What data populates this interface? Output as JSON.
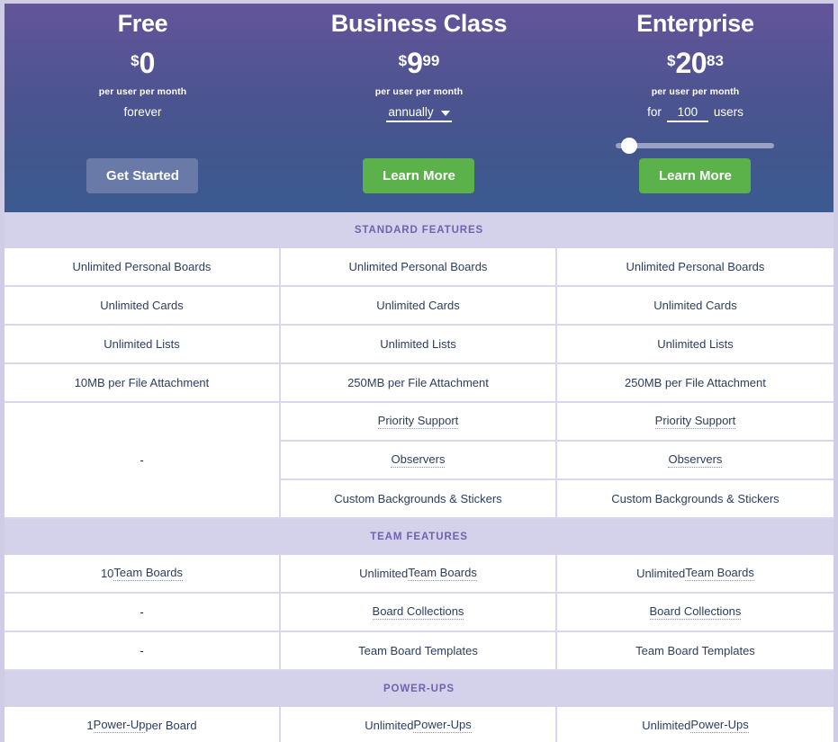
{
  "plans": [
    {
      "name": "Free",
      "currency": "$",
      "price": "0",
      "cents": "",
      "per_unit": "per user per month",
      "term_text": "forever",
      "term_type": "text",
      "cta": "Get Started",
      "cta_style": "secondary"
    },
    {
      "name": "Business Class",
      "currency": "$",
      "price": "9",
      "cents": "99",
      "per_unit": "per user per month",
      "term_text": "annually",
      "term_type": "select",
      "cta": "Learn More",
      "cta_style": "primary"
    },
    {
      "name": "Enterprise",
      "currency": "$",
      "price": "20",
      "cents": "83",
      "per_unit": "per user per month",
      "term_prefix": "for",
      "term_value": "100",
      "term_suffix": "users",
      "term_type": "stepper",
      "slider_value": 0,
      "cta": "Learn More",
      "cta_style": "primary"
    }
  ],
  "sections": [
    {
      "title": "STANDARD FEATURES",
      "rows": [
        {
          "cells": [
            {
              "text": "Unlimited Personal Boards",
              "dotted": false
            },
            {
              "text": "Unlimited Personal Boards",
              "dotted": false
            },
            {
              "text": "Unlimited Personal Boards",
              "dotted": false
            }
          ]
        },
        {
          "cells": [
            {
              "text": "Unlimited Cards",
              "dotted": false
            },
            {
              "text": "Unlimited Cards",
              "dotted": false
            },
            {
              "text": "Unlimited Cards",
              "dotted": false
            }
          ]
        },
        {
          "cells": [
            {
              "text": "Unlimited Lists",
              "dotted": false
            },
            {
              "text": "Unlimited Lists",
              "dotted": false
            },
            {
              "text": "Unlimited Lists",
              "dotted": false
            }
          ]
        },
        {
          "cells": [
            {
              "text": "10MB per File Attachment",
              "dotted": false
            },
            {
              "text": "250MB per File Attachment",
              "dotted": false
            },
            {
              "text": "250MB per File Attachment",
              "dotted": false
            }
          ]
        }
      ],
      "merged_block": {
        "free_text": "-",
        "sub_rows": [
          {
            "cells": [
              {
                "text": "Priority Support",
                "dotted": true
              },
              {
                "text": "Priority Support",
                "dotted": true
              }
            ]
          },
          {
            "cells": [
              {
                "text": "Observers",
                "dotted": true
              },
              {
                "text": "Observers",
                "dotted": true
              }
            ]
          },
          {
            "cells": [
              {
                "text": "Custom Backgrounds & Stickers",
                "dotted": false
              },
              {
                "text": "Custom Backgrounds & Stickers",
                "dotted": false
              }
            ]
          }
        ]
      }
    },
    {
      "title": "TEAM FEATURES",
      "rows": [
        {
          "cells": [
            {
              "prefix": "10 ",
              "text": "Team Boards",
              "dotted": true
            },
            {
              "prefix": "Unlimited ",
              "text": "Team Boards",
              "dotted": true
            },
            {
              "prefix": "Unlimited ",
              "text": "Team Boards",
              "dotted": true
            }
          ]
        },
        {
          "cells": [
            {
              "text": "-",
              "dotted": false
            },
            {
              "text": "Board Collections",
              "dotted": true
            },
            {
              "text": "Board Collections",
              "dotted": true
            }
          ]
        },
        {
          "cells": [
            {
              "text": "-",
              "dotted": false
            },
            {
              "text": "Team Board Templates",
              "dotted": false
            },
            {
              "text": "Team Board Templates",
              "dotted": false
            }
          ]
        }
      ]
    },
    {
      "title": "POWER-UPS",
      "rows": [
        {
          "cells": [
            {
              "prefix": "1 ",
              "text": "Power-Up",
              "suffix": " per Board",
              "dotted": true
            },
            {
              "prefix": "Unlimited ",
              "text": "Power-Ups",
              "dotted": true
            },
            {
              "prefix": "Unlimited ",
              "text": "Power-Ups",
              "dotted": true
            }
          ]
        }
      ]
    }
  ],
  "colors": {
    "hero_gradient_top": "#645499",
    "hero_gradient_bottom": "#3b5b90",
    "cta_primary": "#5bb14a",
    "cta_secondary": "#6a7aa8",
    "section_header_bg": "#d4d2ea",
    "section_header_text": "#6f62ae",
    "cell_text": "#2c3e5d",
    "border": "#d9d7ed"
  }
}
